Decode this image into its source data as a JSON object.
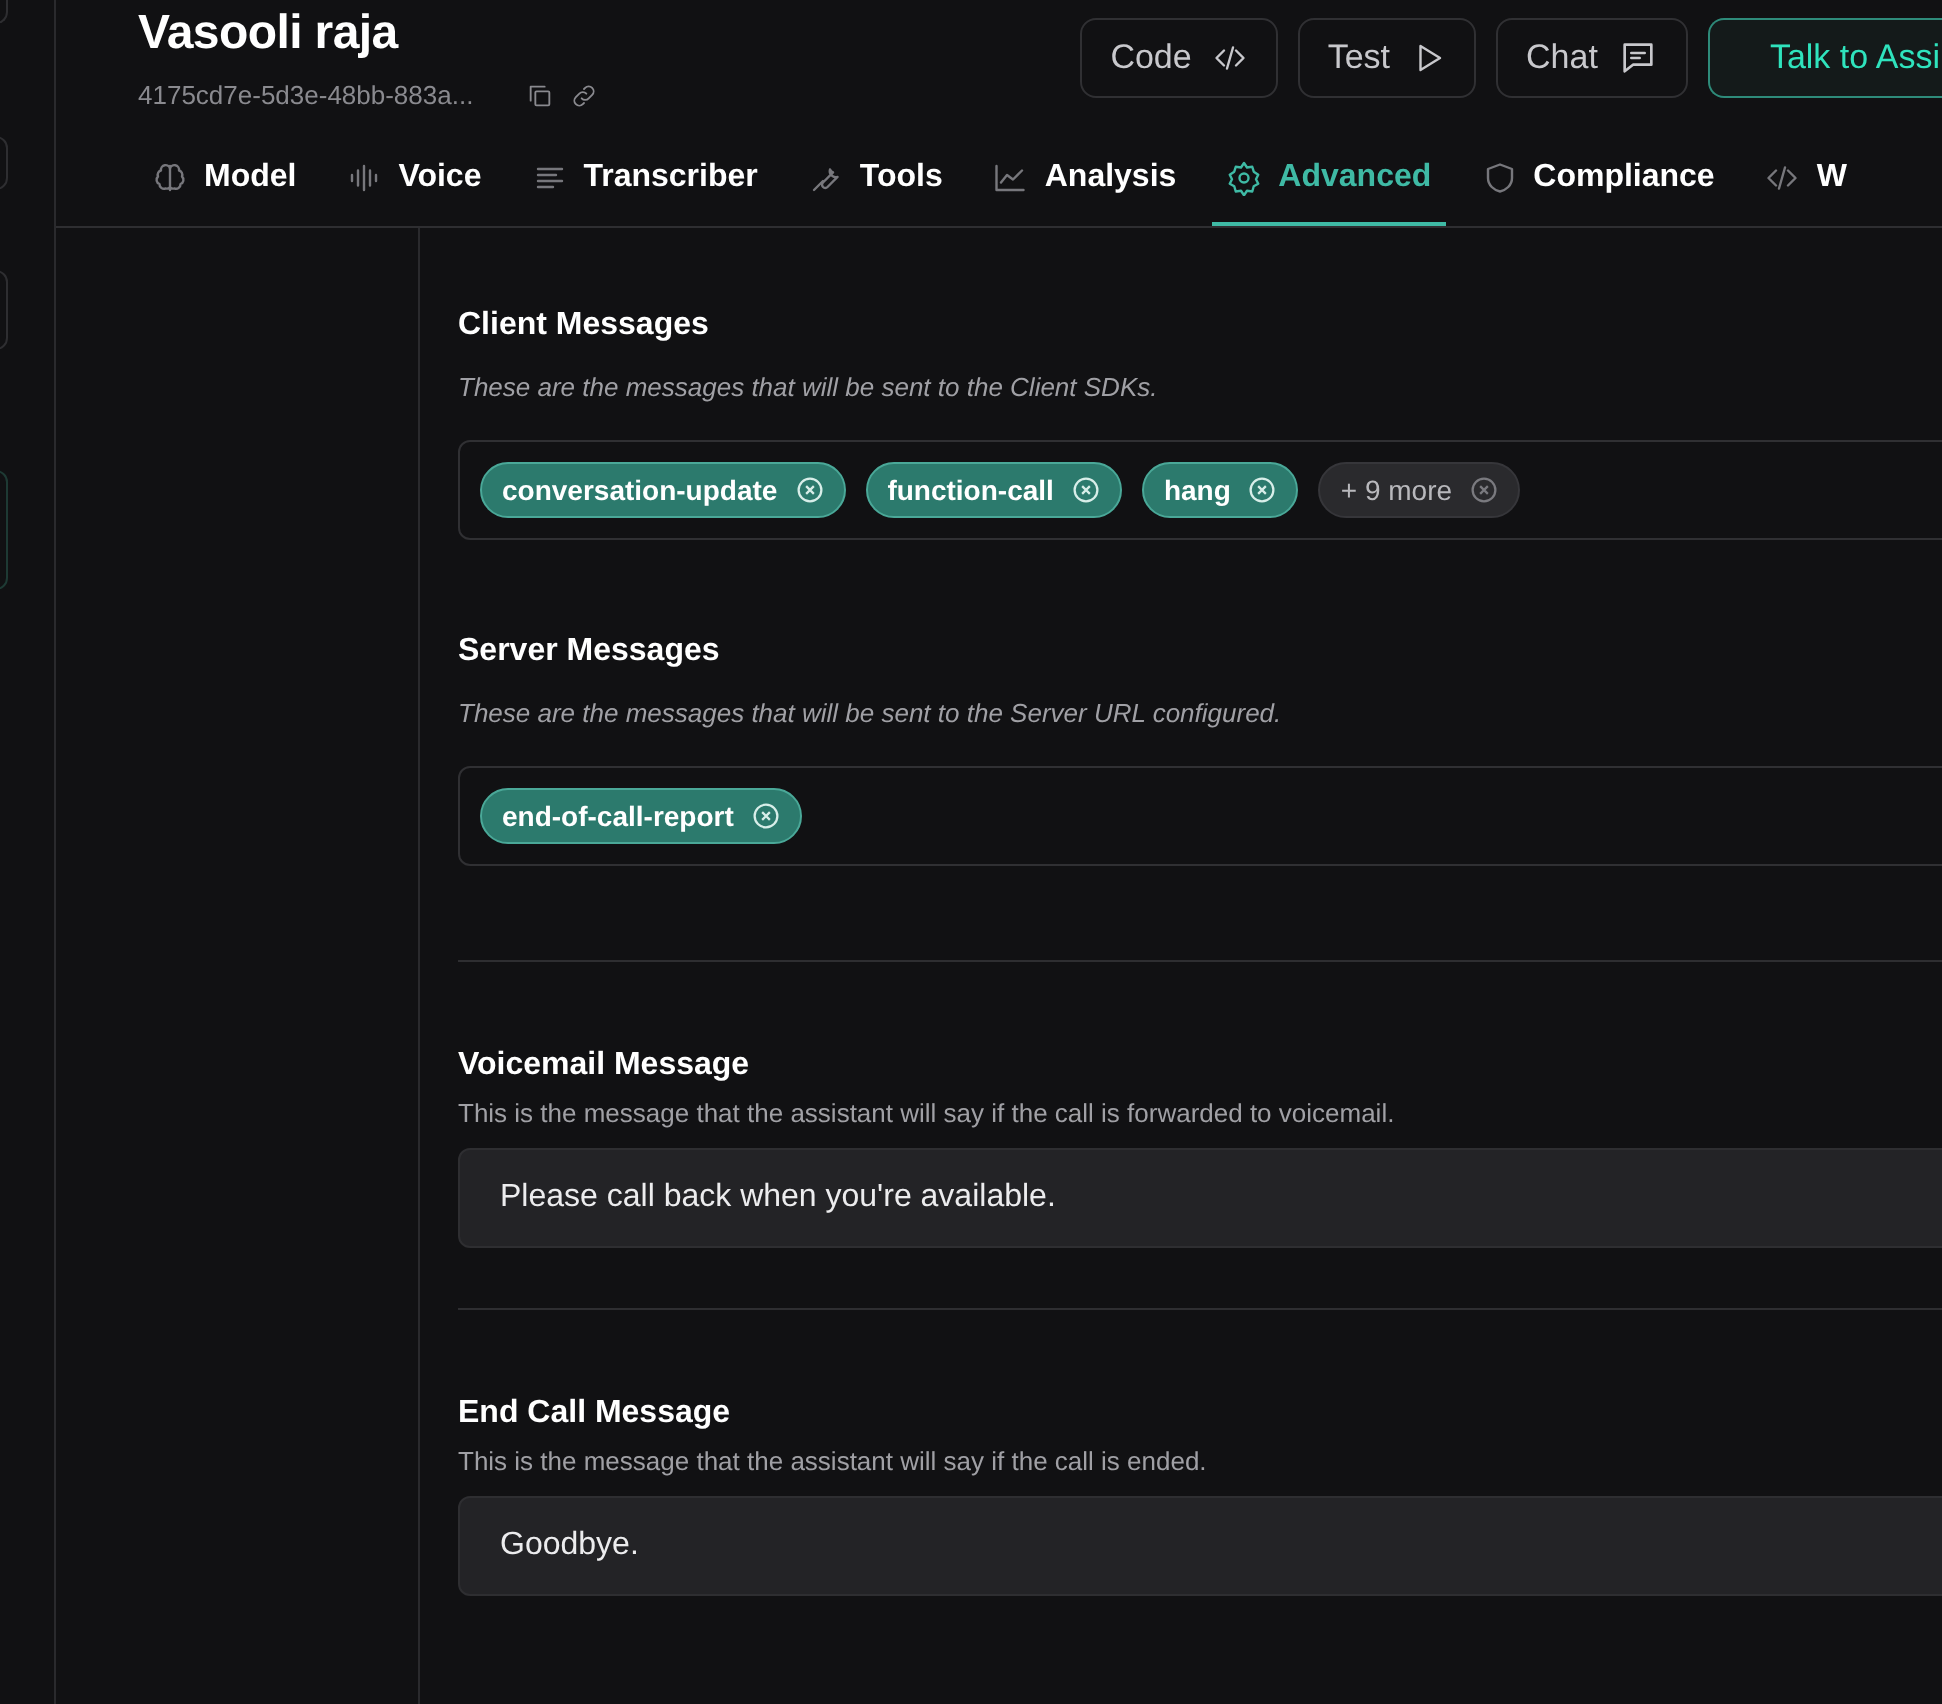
{
  "assistant": {
    "name": "Vasooli raja",
    "id": "4175cd7e-5d3e-48bb-883a..."
  },
  "actions": [
    {
      "label": "Code",
      "kind": "secondary"
    },
    {
      "label": "Test",
      "kind": "secondary"
    },
    {
      "label": "Chat",
      "kind": "secondary"
    },
    {
      "label": "Talk to Assi",
      "kind": "primary"
    }
  ],
  "tabs": [
    {
      "label": "Model",
      "selected": false
    },
    {
      "label": "Voice",
      "selected": false
    },
    {
      "label": "Transcriber",
      "selected": false
    },
    {
      "label": "Tools",
      "selected": false
    },
    {
      "label": "Analysis",
      "selected": false
    },
    {
      "label": "Advanced",
      "selected": true
    },
    {
      "label": "Compliance",
      "selected": false
    },
    {
      "label": "W",
      "selected": false
    }
  ],
  "sections": [
    {
      "kind": "chips",
      "title": "Client Messages",
      "description": "These are the messages that will be sent to the Client SDKs.",
      "chips": [
        {
          "label": "conversation-update",
          "kind": "tag"
        },
        {
          "label": "function-call",
          "kind": "tag"
        },
        {
          "label": "hang",
          "kind": "tag"
        },
        {
          "label": "+ 9 more",
          "kind": "more"
        }
      ]
    },
    {
      "kind": "chips",
      "title": "Server Messages",
      "description": "These are the messages that will be sent to the Server URL configured.",
      "chips": [
        {
          "label": "end-of-call-report",
          "kind": "tag"
        }
      ]
    },
    {
      "kind": "text",
      "title": "Voicemail Message",
      "description": "This is the message that the assistant will say if the call is forwarded to voicemail.",
      "value": "Please call back when you're available."
    },
    {
      "kind": "text",
      "title": "End Call Message",
      "description": "This is the message that the assistant will say if the call is ended.",
      "value": "Goodbye."
    }
  ]
}
